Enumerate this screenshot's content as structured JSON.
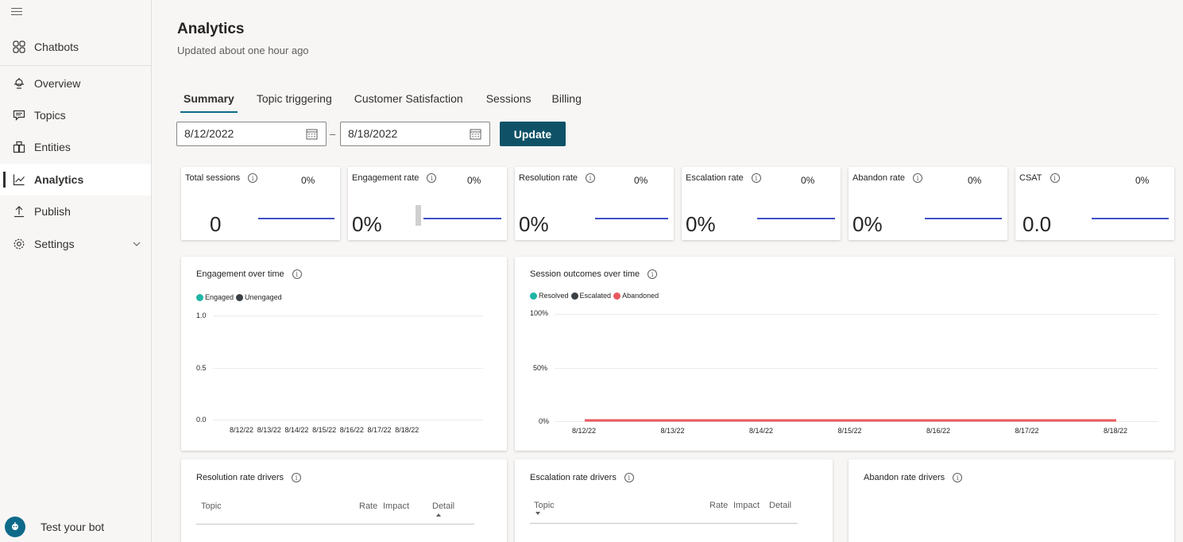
{
  "sidebar": {
    "items": [
      {
        "label": "Chatbots",
        "icon": "apps-grid-icon"
      },
      {
        "label": "Overview",
        "icon": "bot-icon"
      },
      {
        "label": "Topics",
        "icon": "comment-icon"
      },
      {
        "label": "Entities",
        "icon": "entity-icon"
      },
      {
        "label": "Analytics",
        "icon": "chart-line-icon"
      },
      {
        "label": "Publish",
        "icon": "upload-icon"
      },
      {
        "label": "Settings",
        "icon": "gear-icon"
      }
    ],
    "active": "Analytics",
    "test_bot_label": "Test your bot"
  },
  "header": {
    "title": "Analytics",
    "subtitle": "Updated about one hour ago"
  },
  "tabs": [
    "Summary",
    "Topic triggering",
    "Customer Satisfaction",
    "Sessions",
    "Billing"
  ],
  "active_tab": "Summary",
  "date_range": {
    "start": "8/12/2022",
    "separator": "–",
    "end": "8/18/2022",
    "update_label": "Update"
  },
  "kpis": [
    {
      "title": "Total sessions",
      "pct": "0%",
      "value": "0"
    },
    {
      "title": "Engagement rate",
      "pct": "0%",
      "value": "0%"
    },
    {
      "title": "Resolution rate",
      "pct": "0%",
      "value": "0%"
    },
    {
      "title": "Escalation rate",
      "pct": "0%",
      "value": "0%"
    },
    {
      "title": "Abandon rate",
      "pct": "0%",
      "value": "0%"
    },
    {
      "title": "CSAT",
      "pct": "0%",
      "value": "0.0"
    }
  ],
  "colors": {
    "accent": "#0f5268",
    "sparkline": "#4050c8",
    "engaged": "#1fb5a5",
    "unengaged": "#3b4045",
    "resolved": "#1fb5a5",
    "escalated": "#3b4045",
    "abandoned": "#e8595e"
  },
  "chart_data": [
    {
      "type": "line",
      "title": "Engagement over time",
      "legend": [
        "Engaged",
        "Unengaged"
      ],
      "yticks": [
        "1.0",
        "0.5",
        "0.0"
      ],
      "categories": [
        "8/12/22",
        "8/13/22",
        "8/14/22",
        "8/15/22",
        "8/16/22",
        "8/17/22",
        "8/18/22"
      ],
      "series": [],
      "ylim": [
        0,
        1
      ]
    },
    {
      "type": "line",
      "title": "Session outcomes over time",
      "legend": [
        "Resolved",
        "Escalated",
        "Abandoned"
      ],
      "yticks": [
        "100%",
        "50%",
        "0%"
      ],
      "categories": [
        "8/12/22",
        "8/13/22",
        "8/14/22",
        "8/15/22",
        "8/16/22",
        "8/17/22",
        "8/18/22"
      ],
      "series": [
        {
          "name": "Abandoned",
          "values": [
            0,
            0,
            0,
            0,
            0,
            0,
            0
          ]
        }
      ],
      "ylim": [
        0,
        100
      ]
    }
  ],
  "drivers": {
    "resolution": {
      "title": "Resolution rate drivers",
      "cols": [
        "Topic",
        "Rate",
        "Impact",
        "Detail"
      ]
    },
    "escalation": {
      "title": "Escalation rate drivers",
      "cols": [
        "Topic",
        "Rate",
        "Impact",
        "Detail"
      ]
    },
    "abandon": {
      "title": "Abandon rate drivers"
    }
  }
}
